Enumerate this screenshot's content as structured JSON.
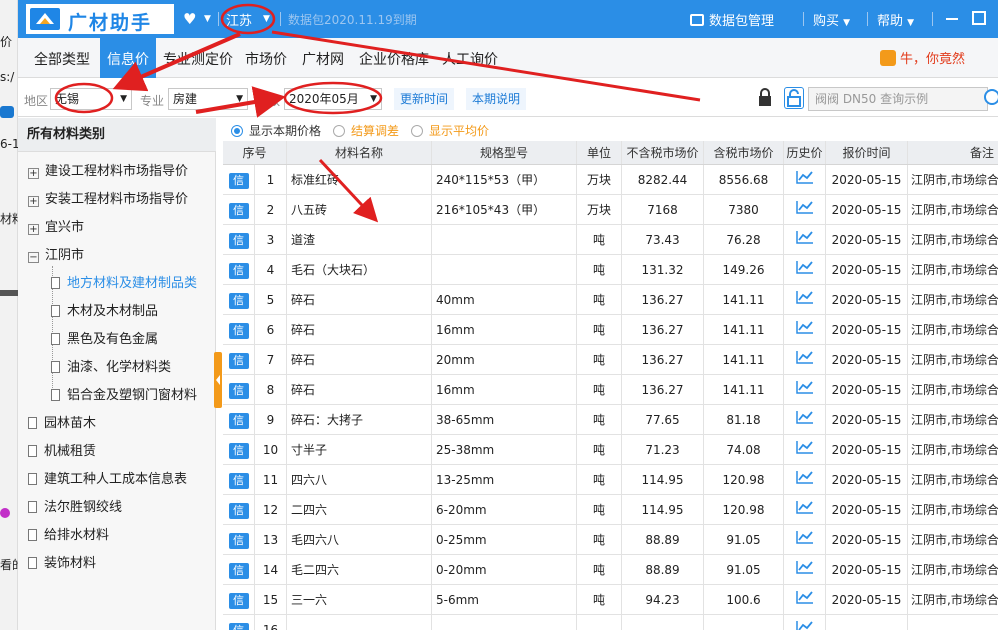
{
  "app": {
    "title": "广材助手",
    "province": "江苏",
    "expire": "数据包2020.11.19到期",
    "pkg_mgr": "数据包管理",
    "buy": "购买",
    "help": "帮助"
  },
  "bg": {
    "l1": "价",
    "l2": "s:/",
    "l3": "6-1",
    "l4": "材料",
    "l5": "看的"
  },
  "nav": {
    "tabs": [
      "全部类型",
      "信息价",
      "专业测定价",
      "市场价",
      "广材网",
      "企业价格库",
      "人工询价"
    ],
    "promo": "牛，你竟然"
  },
  "filter": {
    "region_label": "地区",
    "region": "无锡",
    "major_label": "专业",
    "major": "房建",
    "period_label": "期数",
    "period": "2020年05月",
    "update_btn": "更新时间",
    "notes_btn": "本期说明",
    "search_placeholder": "阀阀 DN50 查询示例"
  },
  "sidebar": {
    "title": "所有材料类别",
    "items": [
      {
        "label": "建设工程材料市场指导价",
        "kind": "plus"
      },
      {
        "label": "安装工程材料市场指导价",
        "kind": "plus"
      },
      {
        "label": "宜兴市",
        "kind": "plus"
      },
      {
        "label": "江阴市",
        "kind": "minus"
      },
      {
        "label": "地方材料及建材制品类",
        "kind": "child-selected"
      },
      {
        "label": "木材及木材制品",
        "kind": "child"
      },
      {
        "label": "黑色及有色金属",
        "kind": "child"
      },
      {
        "label": "油漆、化学材料类",
        "kind": "child"
      },
      {
        "label": "铝合金及塑钢门窗材料",
        "kind": "child"
      },
      {
        "label": "园林苗木",
        "kind": "doc"
      },
      {
        "label": "机械租赁",
        "kind": "doc"
      },
      {
        "label": "建筑工种人工成本信息表",
        "kind": "doc"
      },
      {
        "label": "法尔胜钢绞线",
        "kind": "doc"
      },
      {
        "label": "给排水材料",
        "kind": "doc"
      },
      {
        "label": "装饰材料",
        "kind": "doc"
      }
    ]
  },
  "radios": {
    "r1": "显示本期价格",
    "r2": "结算调差",
    "r3": "显示平均价"
  },
  "table": {
    "headers": {
      "no": "序号",
      "name": "材料名称",
      "spec": "规格型号",
      "unit": "单位",
      "ex": "不含税市场价",
      "inc": "含税市场价",
      "hist": "历史价",
      "date": "报价时间",
      "note": "备注"
    },
    "badge": "信",
    "rows": [
      {
        "no": "1",
        "name": "标准红砖",
        "spec": "240*115*53（甲）",
        "unit": "万块",
        "ex": "8282.44",
        "inc": "8556.68",
        "date": "2020-05-15",
        "note": "江阴市,市场综合"
      },
      {
        "no": "2",
        "name": "八五砖",
        "spec": "216*105*43（甲）",
        "unit": "万块",
        "ex": "7168",
        "inc": "7380",
        "date": "2020-05-15",
        "note": "江阴市,市场综合"
      },
      {
        "no": "3",
        "name": "道渣",
        "spec": "",
        "unit": "吨",
        "ex": "73.43",
        "inc": "76.28",
        "date": "2020-05-15",
        "note": "江阴市,市场综合"
      },
      {
        "no": "4",
        "name": "毛石（大块石）",
        "spec": "",
        "unit": "吨",
        "ex": "131.32",
        "inc": "149.26",
        "date": "2020-05-15",
        "note": "江阴市,市场综合"
      },
      {
        "no": "5",
        "name": "碎石",
        "spec": "40mm",
        "unit": "吨",
        "ex": "136.27",
        "inc": "141.11",
        "date": "2020-05-15",
        "note": "江阴市,市场综合"
      },
      {
        "no": "6",
        "name": "碎石",
        "spec": "16mm",
        "unit": "吨",
        "ex": "136.27",
        "inc": "141.11",
        "date": "2020-05-15",
        "note": "江阴市,市场综合"
      },
      {
        "no": "7",
        "name": "碎石",
        "spec": "20mm",
        "unit": "吨",
        "ex": "136.27",
        "inc": "141.11",
        "date": "2020-05-15",
        "note": "江阴市,市场综合"
      },
      {
        "no": "8",
        "name": "碎石",
        "spec": "16mm",
        "unit": "吨",
        "ex": "136.27",
        "inc": "141.11",
        "date": "2020-05-15",
        "note": "江阴市,市场综合"
      },
      {
        "no": "9",
        "name": "碎石：大拷子",
        "spec": "38-65mm",
        "unit": "吨",
        "ex": "77.65",
        "inc": "81.18",
        "date": "2020-05-15",
        "note": "江阴市,市场综合"
      },
      {
        "no": "10",
        "name": "寸半子",
        "spec": "25-38mm",
        "unit": "吨",
        "ex": "71.23",
        "inc": "74.08",
        "date": "2020-05-15",
        "note": "江阴市,市场综合"
      },
      {
        "no": "11",
        "name": "四六八",
        "spec": "13-25mm",
        "unit": "吨",
        "ex": "114.95",
        "inc": "120.98",
        "date": "2020-05-15",
        "note": "江阴市,市场综合"
      },
      {
        "no": "12",
        "name": "二四六",
        "spec": "6-20mm",
        "unit": "吨",
        "ex": "114.95",
        "inc": "120.98",
        "date": "2020-05-15",
        "note": "江阴市,市场综合"
      },
      {
        "no": "13",
        "name": "毛四六八",
        "spec": "0-25mm",
        "unit": "吨",
        "ex": "88.89",
        "inc": "91.05",
        "date": "2020-05-15",
        "note": "江阴市,市场综合"
      },
      {
        "no": "14",
        "name": "毛二四六",
        "spec": "0-20mm",
        "unit": "吨",
        "ex": "88.89",
        "inc": "91.05",
        "date": "2020-05-15",
        "note": "江阴市,市场综合"
      },
      {
        "no": "15",
        "name": "三一六",
        "spec": "5-6mm",
        "unit": "吨",
        "ex": "94.23",
        "inc": "100.6",
        "date": "2020-05-15",
        "note": "江阴市,市场综合"
      },
      {
        "no": "16",
        "name": "",
        "spec": "",
        "unit": "",
        "ex": "",
        "inc": "",
        "date": "",
        "note": ""
      }
    ]
  },
  "colors": {
    "brand": "#2b8ee6",
    "annotation": "#e02020",
    "accent": "#f39a1a"
  }
}
